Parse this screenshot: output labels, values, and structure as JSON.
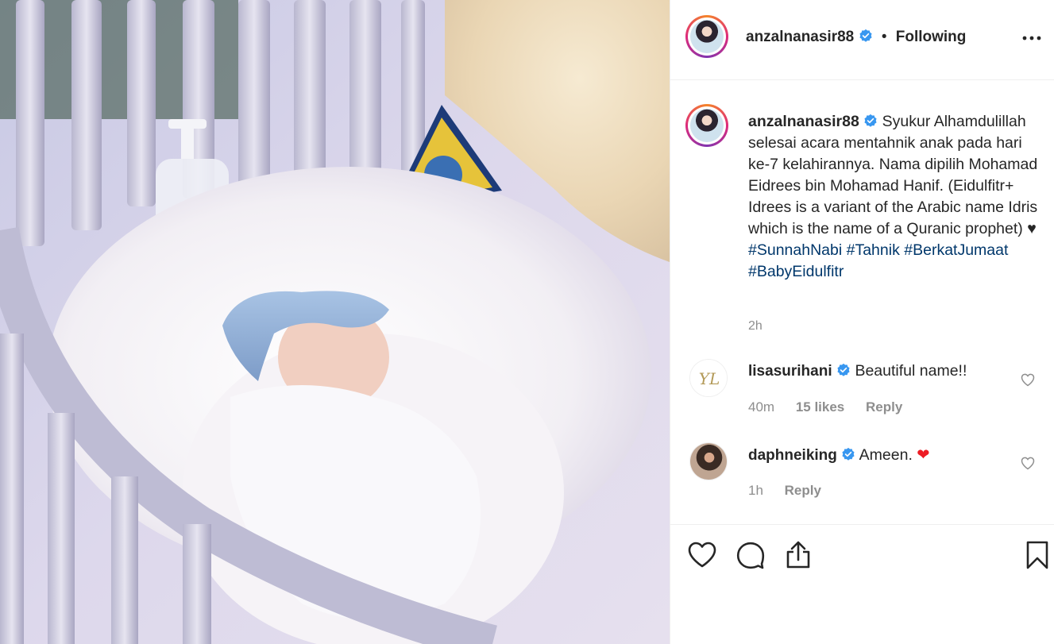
{
  "post": {
    "username": "anzalnanasir88",
    "separator": "•",
    "follow_status": "Following",
    "more_icon": "more-options-icon",
    "verified_color": "#3897f0"
  },
  "caption": {
    "username": "anzalnanasir88",
    "text": "Syukur Alhamdulillah selesai acara mentahnik anak pada hari ke-7 kelahirannya. Nama dipilih Mohamad Eidrees bin Mohamad Hanif. (Eidulfitr+ Idrees is a variant of the Arabic name Idris which is the name of a Quranic prophet) ",
    "heart_emoji": "♥",
    "hashtags": [
      "#SunnahNabi",
      "#Tahnik",
      "#BerkatJumaat",
      "#BabyEidulfitr"
    ],
    "time": "2h"
  },
  "comments": [
    {
      "username": "lisasurihani",
      "avatar_label": "YL",
      "text": "Beautiful name!!",
      "time": "40m",
      "likes": "15 likes",
      "reply": "Reply"
    },
    {
      "username": "daphneiking",
      "text": "Ameen. ",
      "emoji": "❤",
      "time": "1h",
      "reply": "Reply"
    }
  ],
  "actions": {
    "icons": [
      "heart-icon",
      "comment-icon",
      "share-icon",
      "bookmark-icon"
    ]
  },
  "colors": {
    "hashtag": "#00376b",
    "muted": "#8e8e8e",
    "text": "#262626",
    "emoji_heart": "#ed1c24"
  }
}
